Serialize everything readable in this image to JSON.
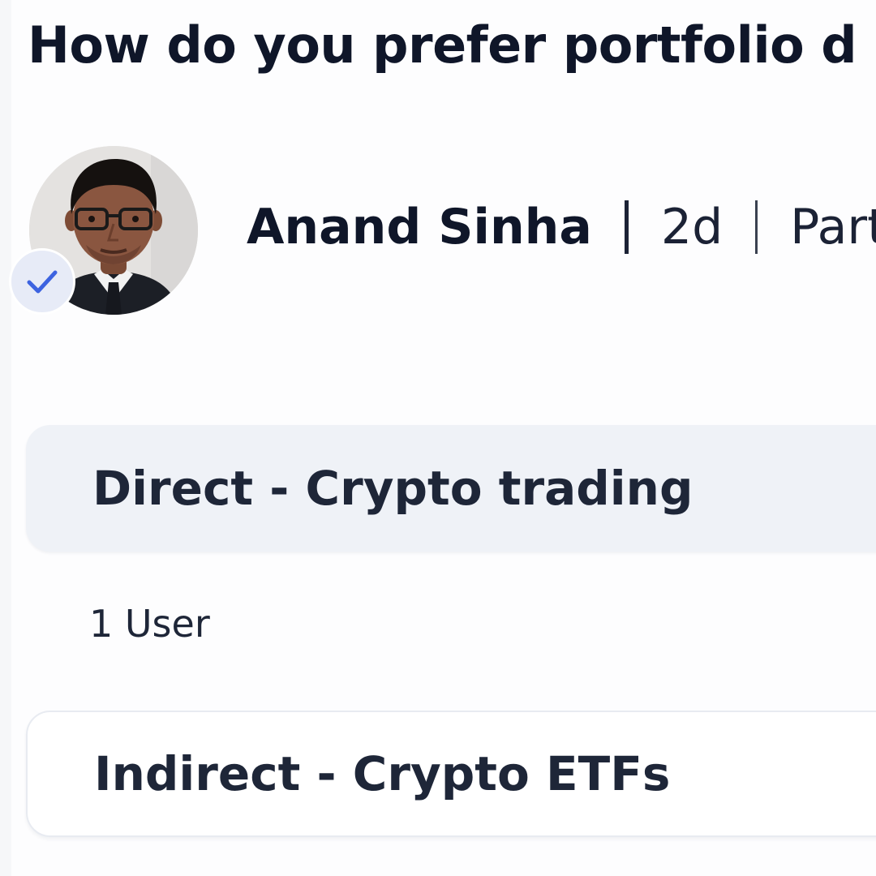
{
  "post": {
    "title": "How do you prefer portfolio d",
    "author": {
      "name": "Anand Sinha",
      "avatar_icon": "user-photo",
      "verified_icon": "check-icon",
      "verified_color": "#3d63e0"
    },
    "age": "2d",
    "category": "Part"
  },
  "poll": {
    "options": [
      {
        "label": "Direct - Crypto trading",
        "selected": true,
        "votes_label": "1 User"
      },
      {
        "label": "Indirect - Crypto ETFs",
        "selected": false
      }
    ]
  },
  "colors": {
    "selected_option_bg": "#eff2f7",
    "text": "#1e2638"
  }
}
